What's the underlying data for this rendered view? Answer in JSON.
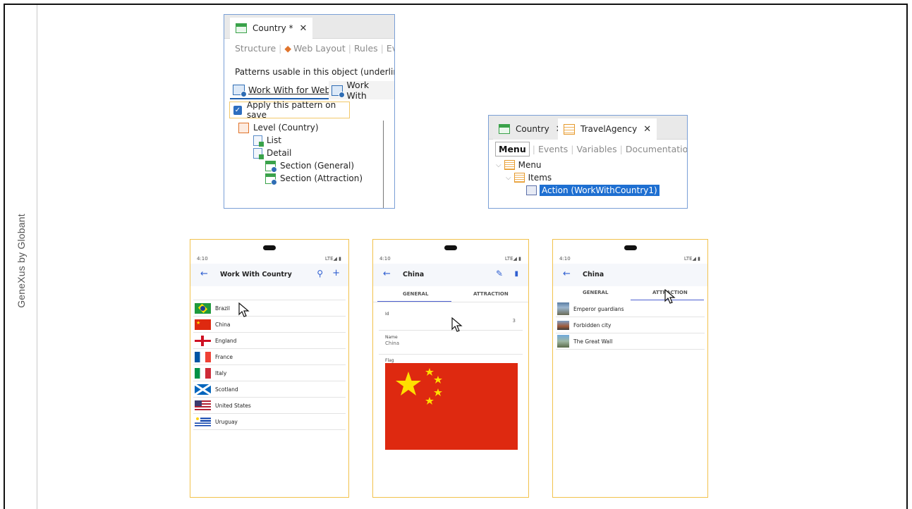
{
  "sidebar_label": "GeneXus by Globant",
  "ide_pattern": {
    "doc_tab": "Country *",
    "close_glyph": "✕",
    "subtabs": [
      "Structure",
      "Web Layout",
      "Rules",
      "Event"
    ],
    "patterns_text": "Patterns usable in this object (underlined r",
    "pattern_tabs": [
      "Work With for Web",
      "Work With"
    ],
    "apply_checkbox": {
      "label": "Apply this pattern on save",
      "checked": true
    },
    "tree": [
      "Level (Country)",
      "List",
      "Detail",
      "Section (General)",
      "Section (Attraction)"
    ]
  },
  "ide_menu": {
    "doc_tabs": [
      "Country",
      "TravelAgency"
    ],
    "close_glyph": "✕",
    "subtabs": [
      "Menu",
      "Events",
      "Variables",
      "Documentation"
    ],
    "tree": [
      "Menu",
      "Items",
      "Action (WorkWithCountry1)"
    ]
  },
  "phone_list": {
    "time": "4:10",
    "status_right": "LTE◢ ▮",
    "back_glyph": "←",
    "title": "Work With Country",
    "search_glyph": "⚲",
    "add_glyph": "+",
    "countries": [
      "Brazil",
      "China",
      "England",
      "France",
      "Italy",
      "Scotland",
      "United States",
      "Uruguay"
    ]
  },
  "phone_detail": {
    "time": "4:10",
    "status_right": "LTE◢ ▮",
    "back_glyph": "←",
    "title": "China",
    "edit_glyph": "✎",
    "delete_glyph": "▮",
    "tabs": [
      "GENERAL",
      "ATTRACTION"
    ],
    "id_label": "Id",
    "id_value": "3",
    "name_label": "Name",
    "name_value": "China",
    "flag_label": "Flag"
  },
  "phone_attractions": {
    "time": "4:10",
    "status_right": "LTE◢ ▮",
    "back_glyph": "←",
    "title": "China",
    "tabs": [
      "GENERAL",
      "ATTRACTION"
    ],
    "attractions": [
      "Emperor guardians",
      "Forbidden city",
      "The Great Wall"
    ]
  },
  "colors": {
    "accent": "#2f5fd1",
    "selection": "#1e6fd1",
    "frame_highlight": "#f2c24c",
    "china_red": "#de2910",
    "china_star": "#ffde00"
  },
  "icons": [
    "grid-icon",
    "menu-object-icon",
    "pattern-icon",
    "level-icon",
    "list-icon",
    "section-icon",
    "action-icon",
    "search-icon",
    "add-icon",
    "edit-icon",
    "delete-icon",
    "back-arrow-icon",
    "mouse-cursor-icon"
  ]
}
